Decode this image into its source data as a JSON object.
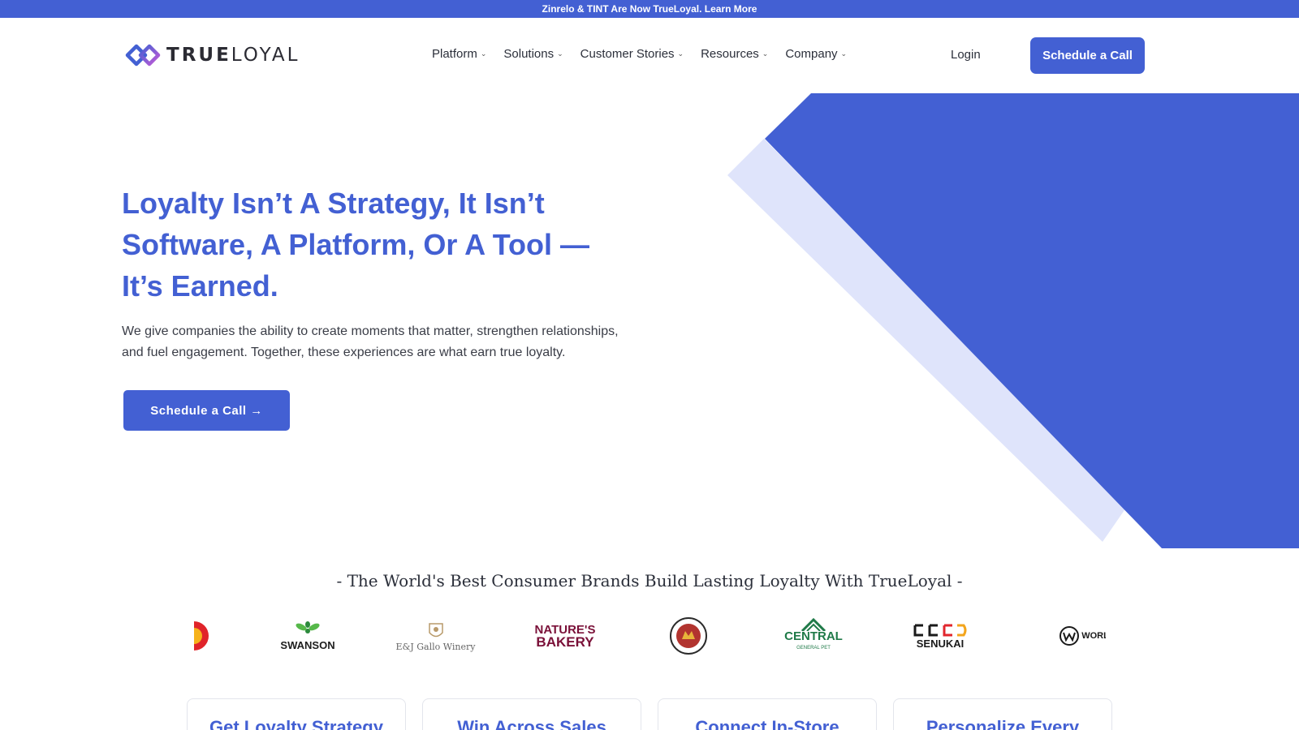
{
  "announcement": {
    "text": "Zinrelo & TINT Are Now TrueLoyal. Learn More"
  },
  "header": {
    "logo": {
      "brand_strong": "TRUE",
      "brand_light": "LOYAL",
      "icon": "trueloyal-logo-icon"
    },
    "nav": [
      {
        "label": "Platform",
        "icon": "chevron-down-icon"
      },
      {
        "label": "Solutions",
        "icon": "chevron-down-icon"
      },
      {
        "label": "Customer Stories",
        "icon": "chevron-down-icon"
      },
      {
        "label": "Resources",
        "icon": "chevron-down-icon"
      },
      {
        "label": "Company",
        "icon": "chevron-down-icon"
      }
    ],
    "login_label": "Login",
    "cta_label": "Schedule a Call"
  },
  "hero": {
    "title_line1": "Loyalty Isn’t A Strategy, It Isn’t",
    "title_line2": "Software, A Platform, Or A Tool —",
    "title_line3": "It’s Earned.",
    "description_line1": "We give companies the ability to create moments that matter, strengthen relationships,",
    "description_line2": "and fuel engagement. Together, these experiences are what earn true loyalty.",
    "cta_label": "Schedule a Call",
    "cta_icon": "arrow-right-icon"
  },
  "brands": {
    "title": "- The World's Best Consumer Brands Build Lasting Loyalty With TrueLoyal -",
    "logos": [
      {
        "name": "swanson",
        "text": "SWANSON"
      },
      {
        "name": "gallo",
        "text": "E&J Gallo Winery"
      },
      {
        "name": "natures-bakery",
        "text1": "NATURE'S",
        "text2": "BAKERY"
      },
      {
        "name": "king-arthur",
        "text": "KING ARTHUR"
      },
      {
        "name": "central",
        "text1": "CENTRAL",
        "text2": "GENERAL PET"
      },
      {
        "name": "senukai",
        "text": "SENUKAI"
      },
      {
        "name": "world",
        "text": "WORL"
      }
    ]
  },
  "cards": [
    {
      "title": "Get Loyalty Strategy"
    },
    {
      "title": "Win Across Sales"
    },
    {
      "title": "Connect In-Store"
    },
    {
      "title": "Personalize Every"
    }
  ],
  "colors": {
    "brand": "#4360d3",
    "light": "#dfe4fb"
  }
}
